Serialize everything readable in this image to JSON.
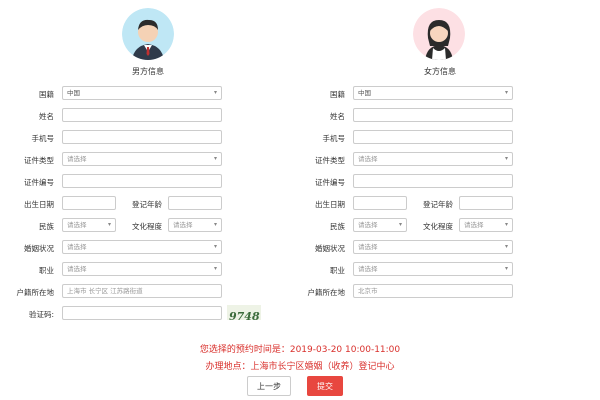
{
  "male": {
    "title": "男方信息",
    "labels": {
      "nationality": "国籍",
      "name": "姓名",
      "phone": "手机号",
      "id_type": "证件类型",
      "id_number": "证件编号",
      "birth": "出生日期",
      "reg_age": "登记年龄",
      "ethnicity": "民族",
      "education": "文化程度",
      "marital": "婚姻状况",
      "occupation": "职业",
      "residence": "户籍所在地"
    },
    "values": {
      "nationality": "中国",
      "id_type": "请选择",
      "ethnicity": "请选择",
      "education": "请选择",
      "marital": "请选择",
      "occupation": "请选择",
      "residence": "上海市 长宁区 江苏路街道"
    }
  },
  "female": {
    "title": "女方信息",
    "labels": {
      "nationality": "国籍",
      "name": "姓名",
      "phone": "手机号",
      "id_type": "证件类型",
      "id_number": "证件编号",
      "birth": "出生日期",
      "reg_age": "登记年龄",
      "ethnicity": "民族",
      "education": "文化程度",
      "marital": "婚姻状况",
      "occupation": "职业",
      "residence": "户籍所在地"
    },
    "values": {
      "nationality": "中国",
      "id_type": "请选择",
      "ethnicity": "请选择",
      "education": "请选择",
      "marital": "请选择",
      "occupation": "请选择",
      "residence": "北京市"
    }
  },
  "captcha": {
    "label": "验证码:",
    "image_text": "9748"
  },
  "appointment": {
    "time": "您选择的预约时间是：2019-03-20 10:00-11:00",
    "place": "办理地点：上海市长宁区婚姻（收养）登记中心"
  },
  "buttons": {
    "back": "上一步",
    "submit": "提交"
  },
  "colors": {
    "accent_red": "#d9302c",
    "submit_bg": "#e8473f"
  }
}
